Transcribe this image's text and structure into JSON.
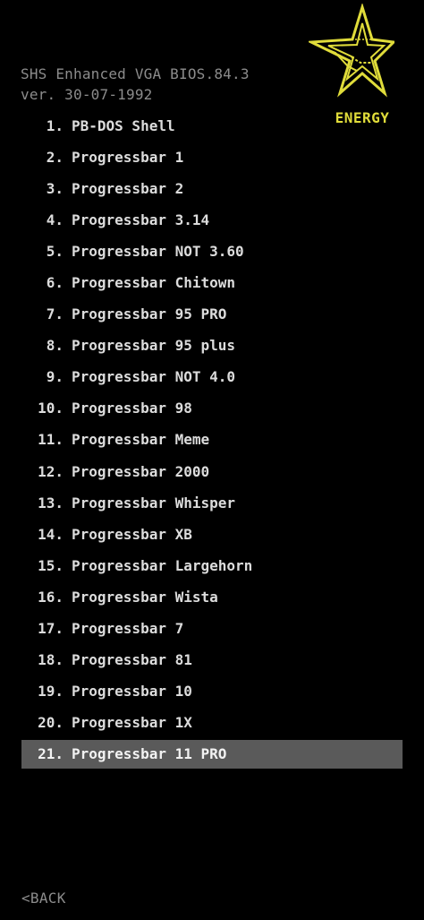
{
  "header": {
    "title": "SHS Enhanced VGA BIOS.84.3",
    "version": "ver. 30-07-1992"
  },
  "logo": {
    "text": "ENERGY",
    "color": "#e0dc3a",
    "icon": "energy-star-icon"
  },
  "menu": {
    "selected_index": 20,
    "items": [
      {
        "num": "1.",
        "label": "PB-DOS Shell"
      },
      {
        "num": "2.",
        "label": "Progressbar 1"
      },
      {
        "num": "3.",
        "label": "Progressbar 2"
      },
      {
        "num": "4.",
        "label": "Progressbar 3.14"
      },
      {
        "num": "5.",
        "label": "Progressbar NOT 3.60"
      },
      {
        "num": "6.",
        "label": "Progressbar Chitown"
      },
      {
        "num": "7.",
        "label": "Progressbar 95 PRO"
      },
      {
        "num": "8.",
        "label": "Progressbar 95 plus"
      },
      {
        "num": "9.",
        "label": "Progressbar NOT 4.0"
      },
      {
        "num": "10.",
        "label": "Progressbar 98"
      },
      {
        "num": "11.",
        "label": "Progressbar Meme"
      },
      {
        "num": "12.",
        "label": "Progressbar 2000"
      },
      {
        "num": "13.",
        "label": "Progressbar Whisper"
      },
      {
        "num": "14.",
        "label": "Progressbar XB"
      },
      {
        "num": "15.",
        "label": "Progressbar Largehorn"
      },
      {
        "num": "16.",
        "label": "Progressbar Wista"
      },
      {
        "num": "17.",
        "label": "Progressbar 7"
      },
      {
        "num": "18.",
        "label": "Progressbar 81"
      },
      {
        "num": "19.",
        "label": "Progressbar 10"
      },
      {
        "num": "20.",
        "label": "Progressbar 1X"
      },
      {
        "num": "21.",
        "label": "Progressbar 11 PRO"
      }
    ]
  },
  "footer": {
    "back_label": "<BACK"
  }
}
